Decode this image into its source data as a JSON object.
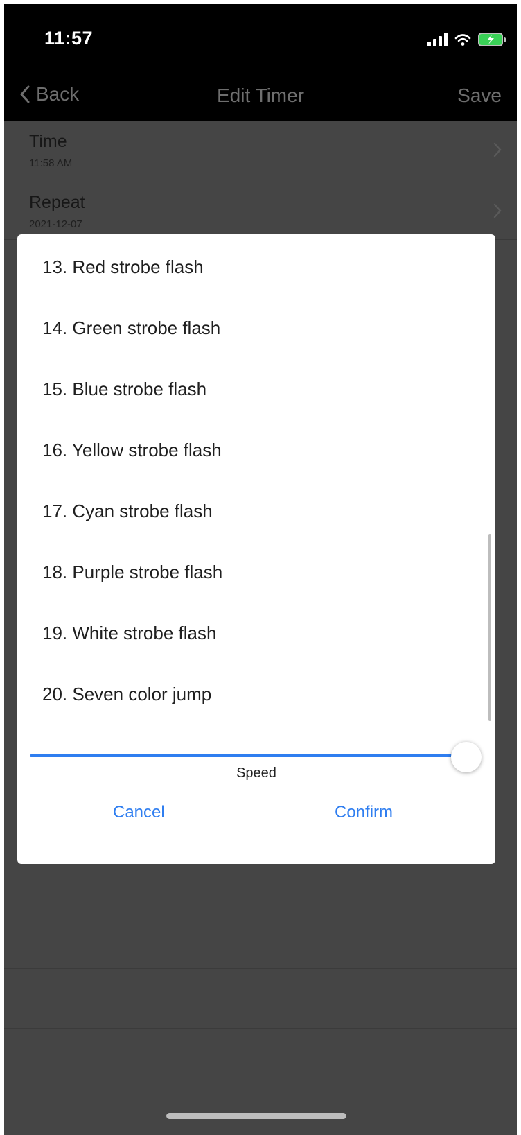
{
  "status_bar": {
    "time": "11:57"
  },
  "nav": {
    "back_label": "Back",
    "title": "Edit Timer",
    "save_label": "Save"
  },
  "rows": [
    {
      "title": "Time",
      "subtitle": "11:58 AM"
    },
    {
      "title": "Repeat",
      "subtitle": "2021-12-07"
    }
  ],
  "modes": [
    "13. Red strobe flash",
    "14. Green strobe flash",
    "15. Blue strobe flash",
    "16. Yellow strobe flash",
    "17. Cyan strobe flash",
    "18. Purple strobe flash",
    "19. White strobe flash",
    "20. Seven color jump"
  ],
  "speed": {
    "label": "Speed",
    "value_fraction": 1.0
  },
  "buttons": {
    "cancel": "Cancel",
    "confirm": "Confirm"
  },
  "colors": {
    "accent": "#2f7ef0",
    "overlay": "#454545",
    "battery": "#3ad157"
  }
}
